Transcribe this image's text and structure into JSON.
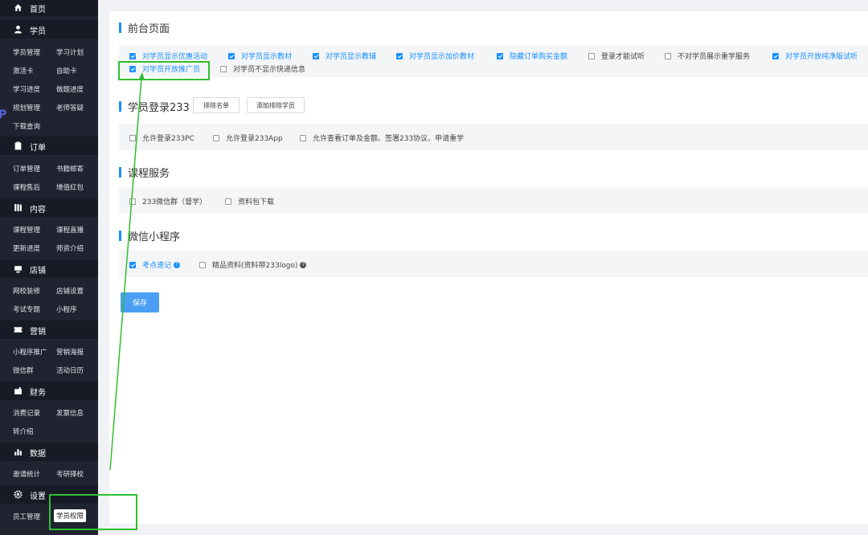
{
  "sidebar": {
    "home": "首页",
    "sections": [
      {
        "label": "学员",
        "icon": "user-icon",
        "items": [
          "学员管理",
          "学习计划",
          "激活卡",
          "自助卡",
          "学习进度",
          "做题进度",
          "规划管理",
          "老师答疑",
          "下载查询"
        ]
      },
      {
        "label": "订单",
        "icon": "order-icon",
        "items": [
          "订单管理",
          "书籍邮寄",
          "课程售后",
          "增值红包"
        ]
      },
      {
        "label": "内容",
        "icon": "book-icon",
        "items": [
          "课程管理",
          "课程直播",
          "更新进度",
          "师资介绍"
        ]
      },
      {
        "label": "店铺",
        "icon": "store-icon",
        "items": [
          "网校装修",
          "店铺设置",
          "考试专题",
          "小程序"
        ]
      },
      {
        "label": "营销",
        "icon": "ticket-icon",
        "items": [
          "小程序推广",
          "营销海报",
          "微信群",
          "活动日历"
        ]
      },
      {
        "label": "财务",
        "icon": "finance-icon",
        "items": [
          "消费记录",
          "发票信息",
          "转介绍"
        ]
      },
      {
        "label": "数据",
        "icon": "chart-icon",
        "items": [
          "邀请统计",
          "考研择校"
        ]
      },
      {
        "label": "设置",
        "icon": "gear-icon",
        "items": [
          "员工管理",
          "学员权限"
        ]
      }
    ]
  },
  "main": {
    "frontend": {
      "title": "前台页面",
      "options": [
        {
          "label": "对学员显示优惠活动",
          "checked": true
        },
        {
          "label": "对学员显示教材",
          "checked": true
        },
        {
          "label": "对学员显示教辅",
          "checked": true
        },
        {
          "label": "对学员显示加价教材",
          "checked": true
        },
        {
          "label": "隐藏订单购买金额",
          "checked": true
        },
        {
          "label": "登录才能试听",
          "checked": false
        },
        {
          "label": "不对学员展示重学服务",
          "checked": false
        },
        {
          "label": "对学员开放纯净版试听",
          "checked": true
        },
        {
          "label": "对学员开放推广员",
          "checked": true
        },
        {
          "label": "对学员不显示快递信息",
          "checked": false
        }
      ]
    },
    "login": {
      "title": "学员登录233",
      "exclude_list_btn": "排除名单",
      "add_exclude_btn": "添加排除学员",
      "options": [
        {
          "label": "允许登录233PC",
          "checked": false
        },
        {
          "label": "允许登录233App",
          "checked": false
        },
        {
          "label": "允许查看订单及金额、签署233协议、申请重学",
          "checked": false
        }
      ]
    },
    "course": {
      "title": "课程服务",
      "options": [
        {
          "label": "233微信群（督学）",
          "checked": false
        },
        {
          "label": "资料包下载",
          "checked": false
        }
      ]
    },
    "miniprogram": {
      "title": "微信小程序",
      "options": [
        {
          "label": "考点速记",
          "checked": true
        },
        {
          "label": "精品资料(资料带233logo)",
          "checked": false
        }
      ]
    },
    "save_label": "保存"
  },
  "colors": {
    "accent": "#1890ff",
    "sidebar_bg": "#1f2430",
    "annotation": "#2fbf2f"
  }
}
